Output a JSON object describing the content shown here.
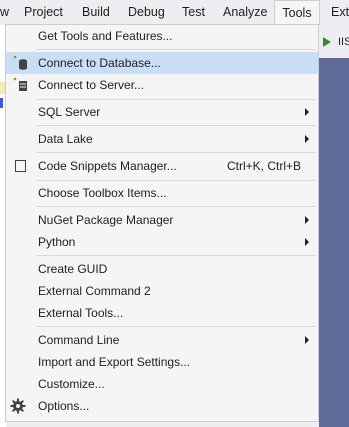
{
  "menubar": {
    "items": [
      "w",
      "Project",
      "Build",
      "Debug",
      "Test",
      "Analyze",
      "Tools",
      "Exte"
    ]
  },
  "toolbar": {
    "run_label": "IIS"
  },
  "tools_menu": {
    "items": [
      {
        "label": "Get Tools and Features...",
        "shortcut": "",
        "submenu": false
      },
      {
        "label": "Connect to Database...",
        "shortcut": "",
        "submenu": false,
        "highlighted": true,
        "icon": "database-icon"
      },
      {
        "label": "Connect to Server...",
        "shortcut": "",
        "submenu": false,
        "icon": "server-icon"
      },
      {
        "label": "SQL Server",
        "shortcut": "",
        "submenu": true
      },
      {
        "label": "Data Lake",
        "shortcut": "",
        "submenu": true
      },
      {
        "label": "Code Snippets Manager...",
        "shortcut": "Ctrl+K, Ctrl+B",
        "submenu": false,
        "icon": "code-snippet-icon"
      },
      {
        "label": "Choose Toolbox Items...",
        "shortcut": "",
        "submenu": false
      },
      {
        "label": "NuGet Package Manager",
        "shortcut": "",
        "submenu": true
      },
      {
        "label": "Python",
        "shortcut": "",
        "submenu": true
      },
      {
        "label": "Create GUID",
        "shortcut": "",
        "submenu": false
      },
      {
        "label": "External Command 2",
        "shortcut": "",
        "submenu": false
      },
      {
        "label": "External Tools...",
        "shortcut": "",
        "submenu": false
      },
      {
        "label": "Command Line",
        "shortcut": "",
        "submenu": true
      },
      {
        "label": "Import and Export Settings...",
        "shortcut": "",
        "submenu": false
      },
      {
        "label": "Customize...",
        "shortcut": "",
        "submenu": false
      },
      {
        "label": "Options...",
        "shortcut": "",
        "submenu": false,
        "icon": "gear-icon"
      }
    ]
  },
  "colors": {
    "highlight": "#c9def5",
    "menu_bg": "#f5f5f5",
    "accent_dark": "#5d6b99",
    "run_green": "#388a34"
  }
}
